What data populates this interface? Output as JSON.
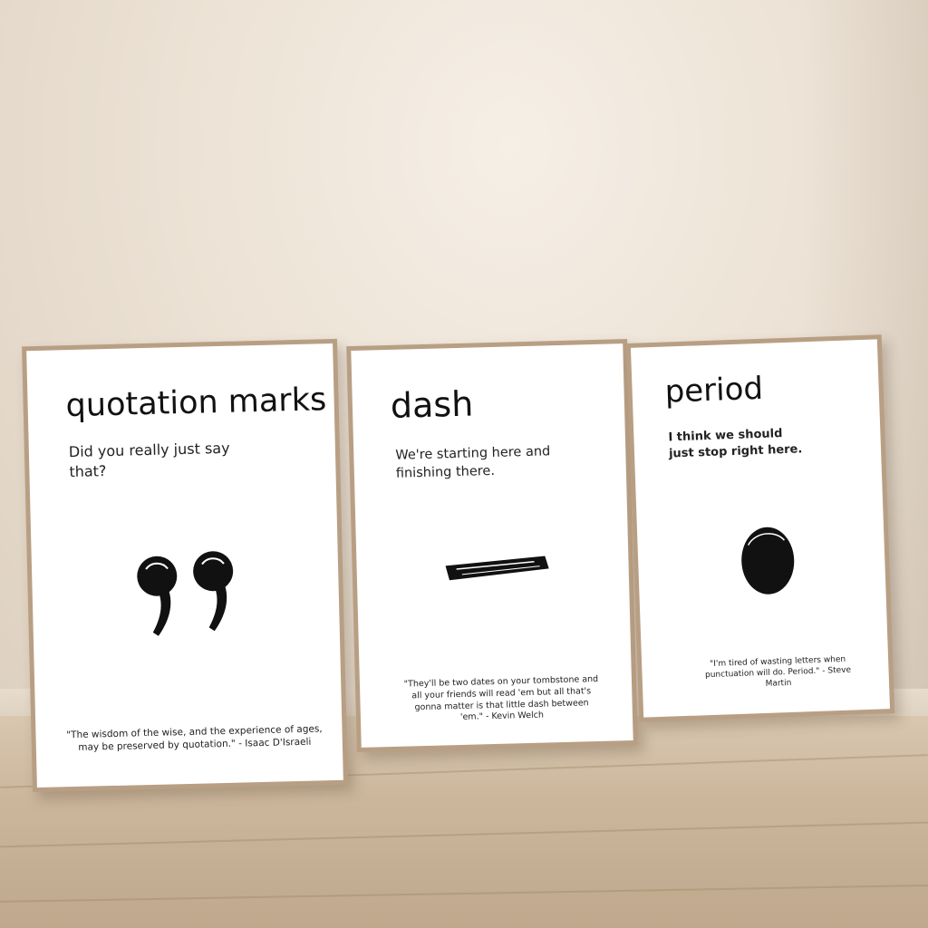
{
  "posters": [
    {
      "title": "quotation marks",
      "subtitle": "Did you really just say that?",
      "quote": "\"The wisdom of the wise, and the experience of ages, may be preserved by quotation.\" - Isaac D'Israeli",
      "symbol": "quotation-marks-icon"
    },
    {
      "title": "dash",
      "subtitle": "We're starting here and finishing there.",
      "quote": "\"They'll be two dates on your tombstone and all your friends will read 'em but all that's gonna matter is that little dash between 'em.\" - Kevin Welch",
      "symbol": "dash-icon"
    },
    {
      "title": "period",
      "subtitle": "I think we should just stop right here.",
      "quote": "\"I'm tired of wasting letters when punctuation will do. Period.\" - Steve Martin",
      "symbol": "period-icon"
    }
  ],
  "colors": {
    "wall": "#ece2d5",
    "floor": "#cbb69c",
    "frame": "#b89f84",
    "ink": "#111111"
  }
}
